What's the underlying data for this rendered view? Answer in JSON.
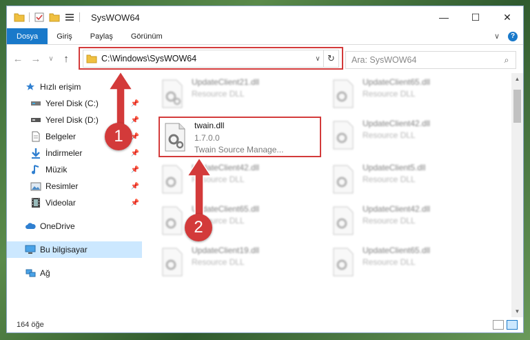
{
  "window": {
    "title": "SysWOW64",
    "controls": {
      "minimize": "—",
      "maximize": "☐",
      "close": "✕"
    }
  },
  "ribbon": {
    "tabs": [
      "Dosya",
      "Giriş",
      "Paylaş",
      "Görünüm"
    ],
    "expand_glyph": "∨",
    "help_glyph": "?"
  },
  "address": {
    "path": "C:\\Windows\\SysWOW64",
    "dropdown_glyph": "∨",
    "refresh_glyph": "↻",
    "back_glyph": "←",
    "forward_glyph": "→",
    "recent_glyph": "∨",
    "up_glyph": "↑"
  },
  "search": {
    "placeholder": "Ara: SysWOW64",
    "icon_glyph": "⌕"
  },
  "sidebar": {
    "quick_access": "Hızlı erişim",
    "items": [
      {
        "label": "Yerel Disk (C:)",
        "icon": "drive-icon"
      },
      {
        "label": "Yerel Disk (D:)",
        "icon": "drive-icon"
      },
      {
        "label": "Belgeler",
        "icon": "documents-icon"
      },
      {
        "label": "İndirmeler",
        "icon": "downloads-icon"
      },
      {
        "label": "Müzik",
        "icon": "music-icon"
      },
      {
        "label": "Resimler",
        "icon": "pictures-icon"
      },
      {
        "label": "Videolar",
        "icon": "videos-icon"
      }
    ],
    "pin_glyph": "📌",
    "onedrive": "OneDrive",
    "this_pc": "Bu bilgisayar",
    "network": "Ağ"
  },
  "files": {
    "left": [
      {
        "name": "UpdateClient21.dll",
        "desc": "Resource DLL"
      },
      {
        "name": "twain.dll",
        "version": "1.7.0.0",
        "desc": "Twain Source Manage..."
      },
      {
        "name": "UpdateClient42.dll",
        "desc": "Resource DLL"
      },
      {
        "name": "UpdateClient65.dll",
        "desc": "Resource DLL"
      },
      {
        "name": "UpdateClient19.dll",
        "desc": "Resource DLL"
      }
    ],
    "right": [
      {
        "name": "UpdateClient65.dll",
        "desc": "Resource DLL"
      },
      {
        "name": "UpdateClient42.dll",
        "desc": "Resource DLL"
      },
      {
        "name": "UpdateClient5.dll",
        "desc": "Resource DLL"
      },
      {
        "name": "UpdateClient42.dll",
        "desc": "Resource DLL"
      },
      {
        "name": "UpdateClient65.dll",
        "desc": "Resource DLL"
      }
    ]
  },
  "status": {
    "count": "164 öğe"
  },
  "annotations": {
    "step1": "1",
    "step2": "2",
    "accent": "#d33a3a"
  },
  "colors": {
    "file_tab": "#1979ca",
    "selected": "#cce8ff",
    "folder": "#f0c040"
  }
}
